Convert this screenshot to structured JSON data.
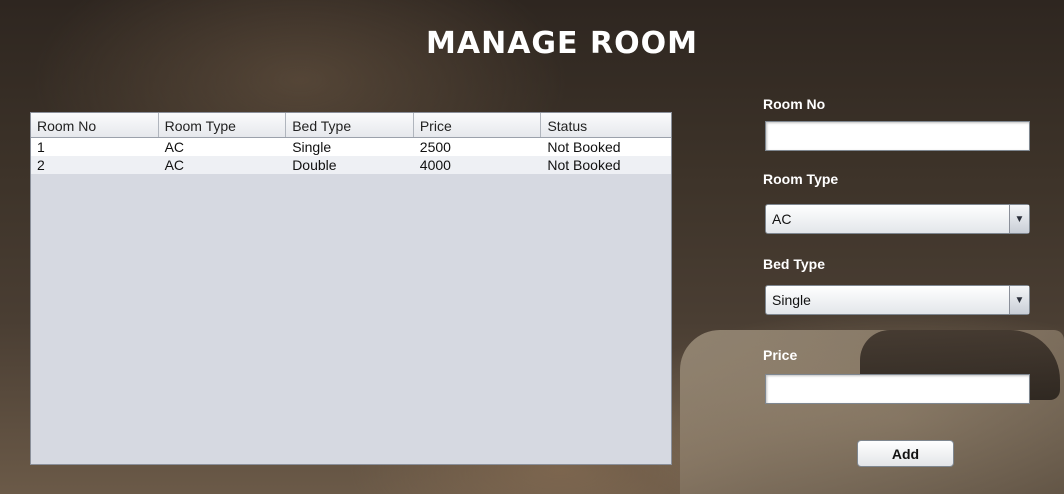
{
  "window": {
    "title": "MANAGE ROOM"
  },
  "table": {
    "headers": [
      "Room No",
      "Room Type",
      "Bed Type",
      "Price",
      "Status"
    ],
    "rows": [
      [
        "1",
        "AC",
        "Single",
        "2500",
        "Not Booked"
      ],
      [
        "2",
        "AC",
        "Double",
        "4000",
        "Not Booked"
      ]
    ]
  },
  "form": {
    "room_no": {
      "label": "Room No",
      "value": ""
    },
    "room_type": {
      "label": "Room Type",
      "value": "AC",
      "arrow_icon": "triangle-down"
    },
    "bed_type": {
      "label": "Bed Type",
      "value": "Single",
      "arrow_icon": "triangle-down"
    },
    "price": {
      "label": "Price",
      "value": ""
    },
    "add_label": "Add"
  },
  "colors": {
    "title": "#ffffff",
    "table_background": "#d6d9e1",
    "label": "#ffffff"
  }
}
